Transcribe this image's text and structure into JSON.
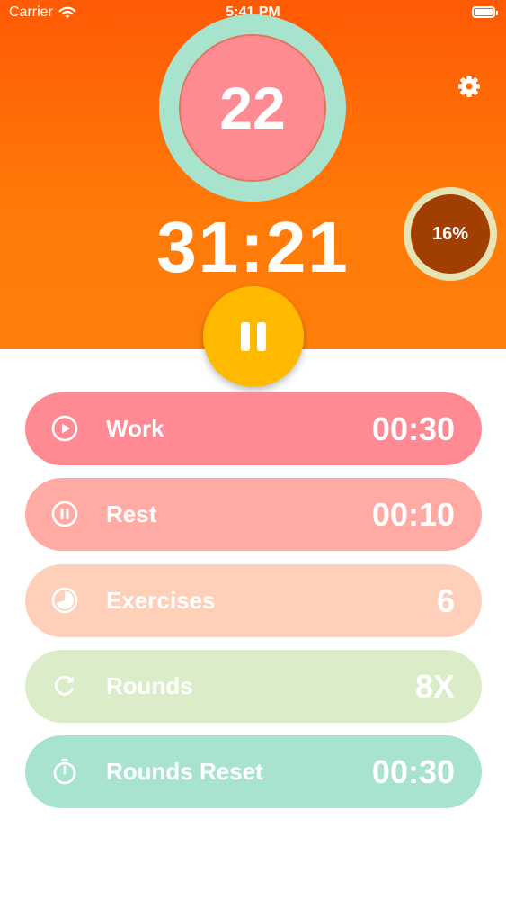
{
  "status_bar": {
    "carrier": "Carrier",
    "time": "5:41 PM"
  },
  "timer": {
    "current_count": "22",
    "remaining_time": "31:21",
    "progress_label": "16%",
    "progress_value": 0.16
  },
  "settings": [
    {
      "label": "Work",
      "value": "00:30",
      "icon": "play-circle-icon",
      "color": "#ff8a93"
    },
    {
      "label": "Rest",
      "value": "00:10",
      "icon": "pause-circle-icon",
      "color": "#ffaaa3"
    },
    {
      "label": "Exercises",
      "value": "6",
      "icon": "pie-chart-icon",
      "color": "#ffd0b9"
    },
    {
      "label": "Rounds",
      "value": "8X",
      "icon": "refresh-icon",
      "color": "#dbedc8"
    },
    {
      "label": "Rounds Reset",
      "value": "00:30",
      "icon": "stopwatch-icon",
      "color": "#a8e3cd"
    }
  ],
  "colors": {
    "hero_gradient_top": "#ff5a05",
    "hero_gradient_bottom": "#ff7f0c",
    "count_ring": "#a8e3cd",
    "count_fill": "#ff8b92",
    "progress_ring": "#e6e4b4",
    "progress_fill": "#a13f02",
    "pause_button": "#ffba00"
  }
}
